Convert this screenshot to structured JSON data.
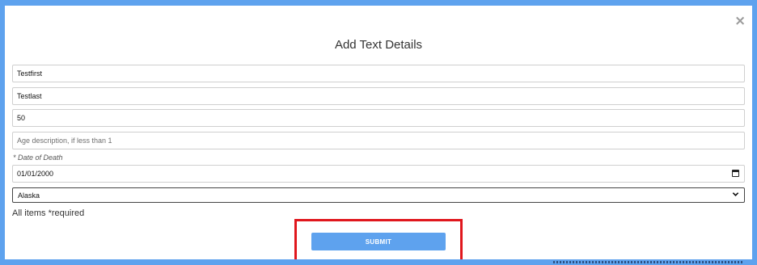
{
  "modal": {
    "title": "Add Text Details",
    "close_label": "×"
  },
  "form": {
    "first_name": {
      "value": "Testfirst",
      "placeholder": ""
    },
    "last_name": {
      "value": "Testlast",
      "placeholder": ""
    },
    "age": {
      "value": "50",
      "placeholder": ""
    },
    "age_description": {
      "value": "",
      "placeholder": "Age description, if less than 1"
    },
    "date_of_death_label": "* Date of Death",
    "date_of_death": {
      "value": "01/01/2000",
      "icon": "calendar-icon"
    },
    "state": {
      "value": "Alaska",
      "icon": "chevron-down-icon"
    },
    "required_note": "All items *required",
    "submit_label": "SUBMIT"
  },
  "colors": {
    "accent": "#5ea2ee",
    "highlight": "#e0171d"
  }
}
